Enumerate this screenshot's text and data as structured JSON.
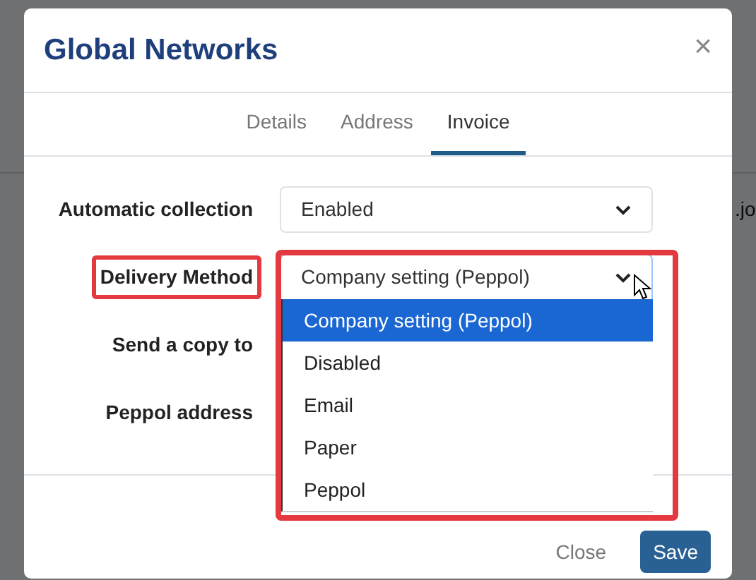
{
  "background": {
    "text_fragment": ".jo"
  },
  "dialog": {
    "title": "Global Networks",
    "close_symbol": "×"
  },
  "tabs": [
    {
      "label": "Details",
      "selected": false
    },
    {
      "label": "Address",
      "selected": false
    },
    {
      "label": "Invoice",
      "selected": true
    }
  ],
  "fields": [
    {
      "label": "Automatic collection",
      "kind": "select",
      "value": "Enabled",
      "open": false,
      "highlighted": false
    },
    {
      "label": "Delivery Method",
      "kind": "select",
      "value": "Company setting (Peppol)",
      "open": true,
      "highlighted": true,
      "options": [
        {
          "label": "Company setting (Peppol)",
          "selected": true
        },
        {
          "label": "Disabled",
          "selected": false
        },
        {
          "label": "Email",
          "selected": false
        },
        {
          "label": "Paper",
          "selected": false
        },
        {
          "label": "Peppol",
          "selected": false
        }
      ]
    },
    {
      "label": "Send a copy to",
      "kind": "covered",
      "highlighted": false
    },
    {
      "label": "Peppol address",
      "kind": "covered",
      "highlighted": false
    }
  ],
  "footer_buttons": [
    {
      "label": "Close",
      "kind": "secondary"
    },
    {
      "label": "Save",
      "kind": "primary"
    }
  ]
}
